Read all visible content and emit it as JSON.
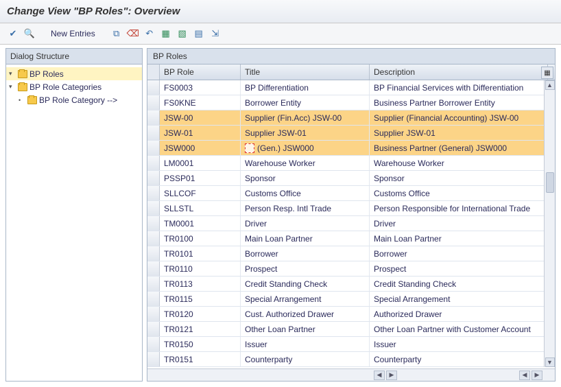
{
  "header": {
    "title": "Change View \"BP Roles\": Overview"
  },
  "toolbar": {
    "new_entries_label": "New Entries",
    "icons": {
      "execute": "execute-icon",
      "find": "find-icon",
      "copy": "copy-icon",
      "delete": "delete-icon",
      "undo": "undo-icon",
      "select_all": "select-all-icon",
      "deselect_all": "deselect-all-icon",
      "table_settings": "table-settings-icon",
      "export": "export-icon"
    }
  },
  "tree": {
    "title": "Dialog Structure",
    "nodes": [
      {
        "label": "BP Roles",
        "level": 0,
        "selected": true,
        "expanded": true
      },
      {
        "label": "BP Role Categories",
        "level": 0,
        "selected": false,
        "expanded": true
      },
      {
        "label": "BP Role Category -->",
        "level": 1,
        "selected": false,
        "expanded": false
      }
    ]
  },
  "table": {
    "title": "BP Roles",
    "columns": {
      "role": "BP Role",
      "title": "Title",
      "desc": "Description"
    },
    "rows": [
      {
        "role": "FS0003",
        "title": "BP Differentiation",
        "desc": "BP Financial Services with Differentiation",
        "highlight": false,
        "editing": false
      },
      {
        "role": "FS0KNE",
        "title": "Borrower Entity",
        "desc": "Business Partner Borrower Entity",
        "highlight": false,
        "editing": false
      },
      {
        "role": "JSW-00",
        "title": "Supplier (Fin.Acc) JSW-00",
        "desc": "Supplier (Financial Accounting) JSW-00",
        "highlight": true,
        "editing": false
      },
      {
        "role": "JSW-01",
        "title": "Supplier JSW-01",
        "desc": "Supplier JSW-01",
        "highlight": true,
        "editing": false
      },
      {
        "role": "JSW000",
        "title": "(Gen.) JSW000",
        "desc": "Business Partner (General) JSW000",
        "highlight": true,
        "editing": true
      },
      {
        "role": "LM0001",
        "title": "Warehouse Worker",
        "desc": "Warehouse Worker",
        "highlight": false,
        "editing": false
      },
      {
        "role": "PSSP01",
        "title": "Sponsor",
        "desc": "Sponsor",
        "highlight": false,
        "editing": false
      },
      {
        "role": "SLLCOF",
        "title": "Customs Office",
        "desc": "Customs Office",
        "highlight": false,
        "editing": false
      },
      {
        "role": "SLLSTL",
        "title": "Person Resp. Intl Trade",
        "desc": "Person Responsible for International Trade",
        "highlight": false,
        "editing": false
      },
      {
        "role": "TM0001",
        "title": "Driver",
        "desc": "Driver",
        "highlight": false,
        "editing": false
      },
      {
        "role": "TR0100",
        "title": "Main Loan Partner",
        "desc": "Main Loan Partner",
        "highlight": false,
        "editing": false
      },
      {
        "role": "TR0101",
        "title": "Borrower",
        "desc": "Borrower",
        "highlight": false,
        "editing": false
      },
      {
        "role": "TR0110",
        "title": "Prospect",
        "desc": "Prospect",
        "highlight": false,
        "editing": false
      },
      {
        "role": "TR0113",
        "title": "Credit Standing Check",
        "desc": "Credit Standing Check",
        "highlight": false,
        "editing": false
      },
      {
        "role": "TR0115",
        "title": "Special Arrangement",
        "desc": "Special Arrangement",
        "highlight": false,
        "editing": false
      },
      {
        "role": "TR0120",
        "title": "Cust. Authorized Drawer",
        "desc": "Authorized Drawer",
        "highlight": false,
        "editing": false
      },
      {
        "role": "TR0121",
        "title": "Other Loan Partner",
        "desc": "Other Loan Partner with Customer Account",
        "highlight": false,
        "editing": false
      },
      {
        "role": "TR0150",
        "title": "Issuer",
        "desc": "Issuer",
        "highlight": false,
        "editing": false
      },
      {
        "role": "TR0151",
        "title": "Counterparty",
        "desc": "Counterparty",
        "highlight": false,
        "editing": false
      }
    ]
  }
}
